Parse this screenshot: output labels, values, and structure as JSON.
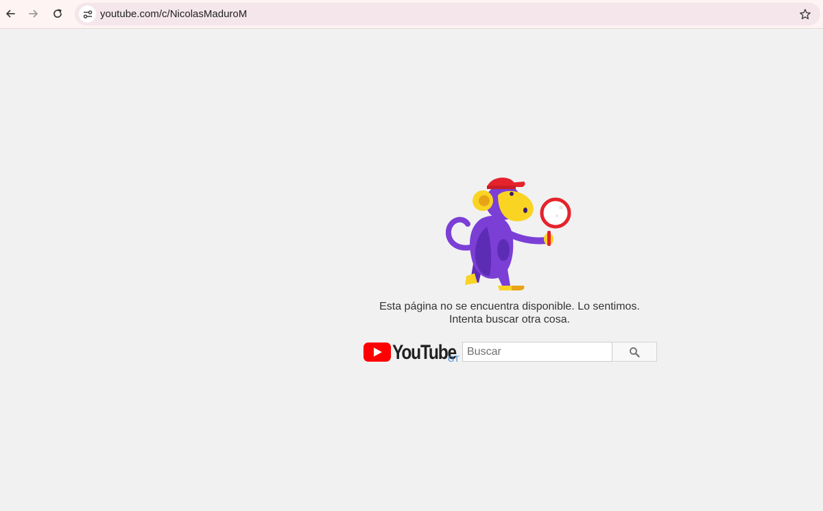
{
  "browser": {
    "url": "youtube.com/c/NicolasMaduroM",
    "icons": {
      "back": "arrow-left-icon",
      "forward": "arrow-right-icon",
      "reload": "reload-icon",
      "site_info": "tune-icon",
      "bookmark": "star-icon"
    }
  },
  "error_page": {
    "illustration": "monkey-with-magnifying-glass",
    "message_line1": "Esta página no se encuentra disponible. Lo sentimos.",
    "message_line2": "Intenta buscar otra cosa.",
    "logo_text": "YouTube",
    "country_code": "GT",
    "search": {
      "placeholder": "Buscar",
      "value": ""
    },
    "colors": {
      "youtube_red": "#ff0000",
      "monkey_purple": "#7b3fd6",
      "monkey_face": "#f9d423",
      "cap_red": "#e5232c"
    }
  }
}
